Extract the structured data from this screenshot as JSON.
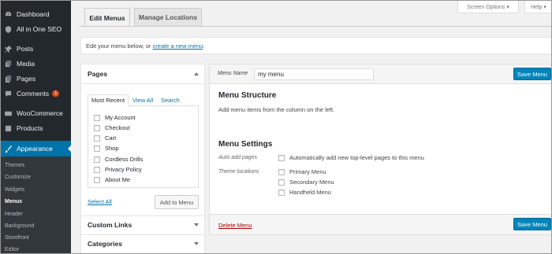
{
  "sidebar": {
    "items": [
      {
        "label": "Dashboard",
        "icon": "dashboard-icon"
      },
      {
        "label": "All in One SEO",
        "icon": "seo-icon"
      },
      {
        "label": "Posts",
        "icon": "pin-icon"
      },
      {
        "label": "Media",
        "icon": "media-icon"
      },
      {
        "label": "Pages",
        "icon": "page-icon"
      },
      {
        "label": "Comments",
        "icon": "comment-icon",
        "badge": "1"
      },
      {
        "label": "WooCommerce",
        "icon": "woocommerce-icon"
      },
      {
        "label": "Products",
        "icon": "products-icon"
      },
      {
        "label": "Appearance",
        "icon": "brush-icon"
      }
    ],
    "submenu": [
      "Themes",
      "Customize",
      "Widgets",
      "Menus",
      "Header",
      "Background",
      "Storefront",
      "Editor"
    ],
    "current": "Menus"
  },
  "top": {
    "screen_options": "Screen Options ▾",
    "help": "Help ▾"
  },
  "tabs": {
    "edit": "Edit Menus",
    "manage": "Manage Locations"
  },
  "info": {
    "text": "Edit your menu below, or",
    "link": "create a new menu",
    "end": "."
  },
  "pages_panel": {
    "title": "Pages",
    "tabs": [
      "Most Recent",
      "View All",
      "Search"
    ],
    "items": [
      "My Account",
      "Checkout",
      "Cart",
      "Shop",
      "Cordless Drills",
      "Privacy Policy",
      "About Me"
    ],
    "select_all": "Select All",
    "add_button": "Add to Menu"
  },
  "panels": {
    "custom_links": "Custom Links",
    "categories": "Categories"
  },
  "menu": {
    "name_label": "Menu Name",
    "name_value": "my menu",
    "save": "Save Menu",
    "structure_title": "Menu Structure",
    "structure_hint": "Add menu items from the column on the left.",
    "settings_title": "Menu Settings",
    "auto_add_label": "Auto add pages",
    "auto_add_option": "Automatically add new top-level pages to this menu",
    "locations_label": "Theme locations",
    "locations": [
      "Primary Menu",
      "Secondary Menu",
      "Handheld Menu"
    ],
    "delete": "Delete Menu"
  },
  "colors": {
    "sidebar": "#23282d",
    "accent": "#0073aa",
    "button": "#0085ba",
    "delete": "#aa0000"
  }
}
